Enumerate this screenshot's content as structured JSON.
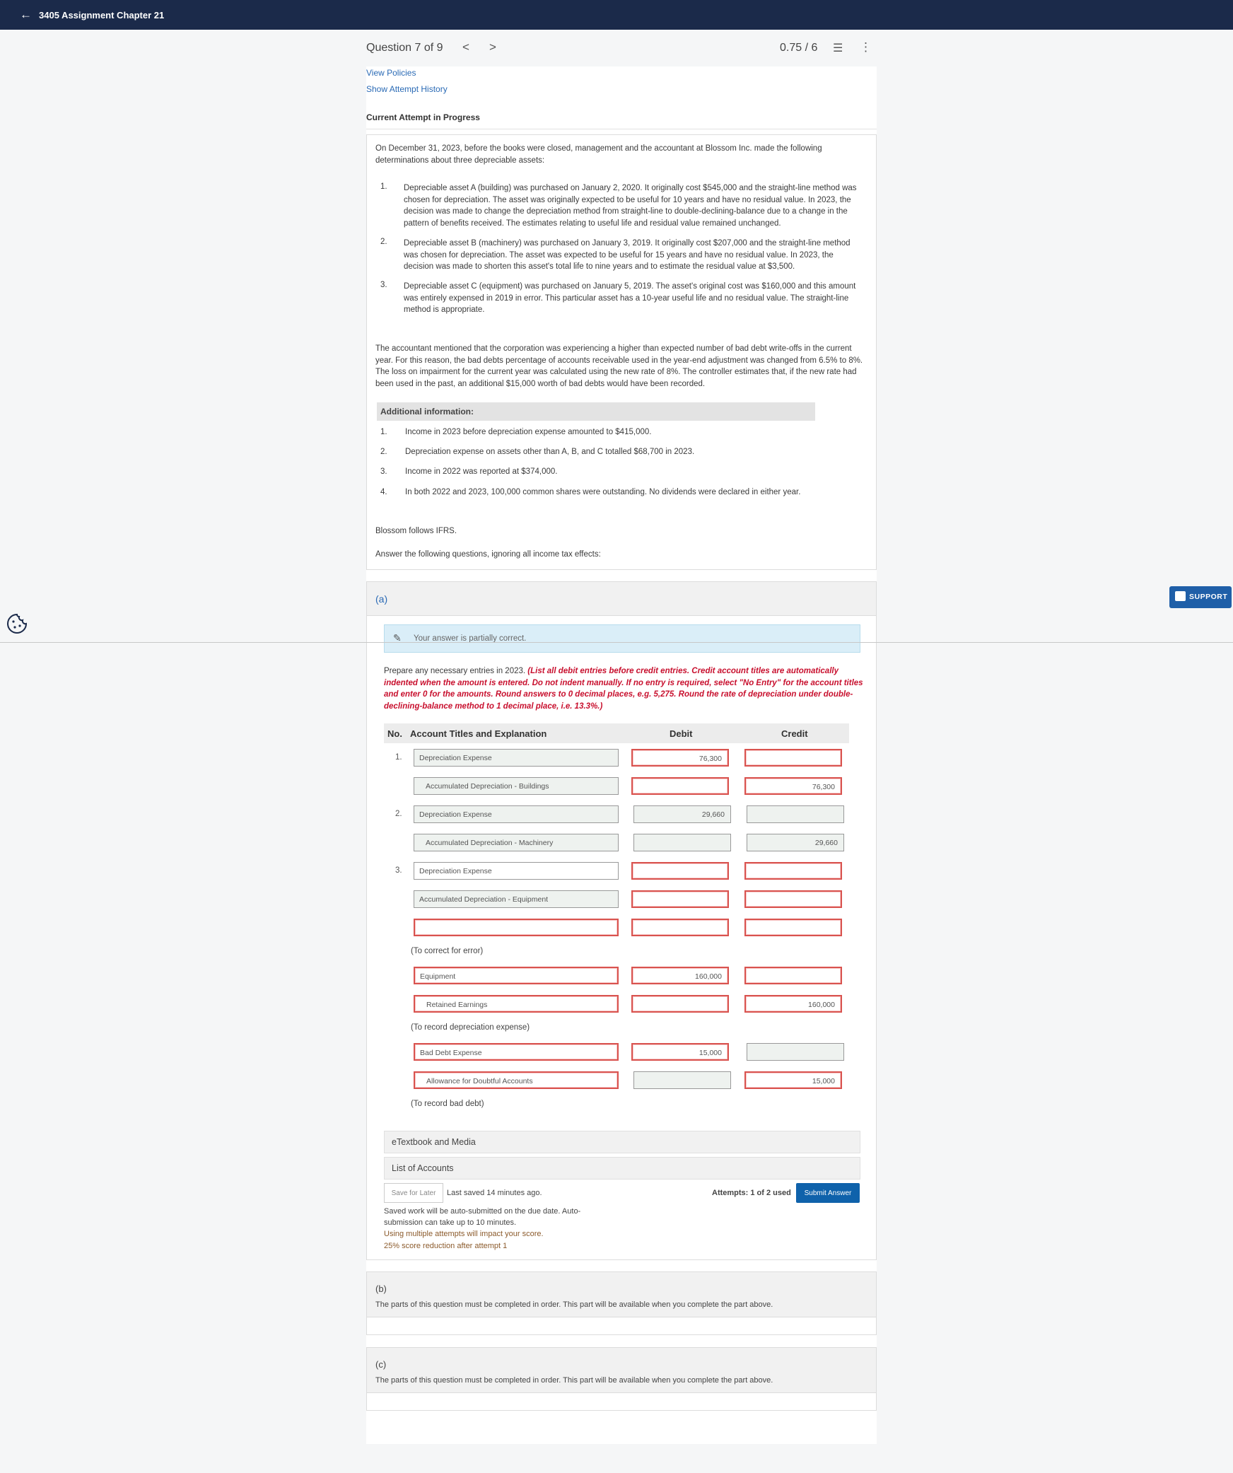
{
  "topbar": {
    "back_icon": "arrow-left-icon",
    "title": "3405 Assignment Chapter 21"
  },
  "header": {
    "question_label": "Question 7 of 9",
    "prev": "<",
    "next": ">",
    "score": "0.75 / 6",
    "list_icon": "☰",
    "more_icon": "⋮"
  },
  "links": {
    "view_policies": "View Policies",
    "show_attempt_history": "Show Attempt History"
  },
  "attempt_title": "Current Attempt in Progress",
  "question": {
    "intro": "On December 31, 2023, before the books were closed, management and the accountant at Blossom Inc. made the following determinations about three depreciable assets:",
    "items": [
      {
        "n": "1.",
        "text": "Depreciable asset A (building) was purchased on January 2, 2020. It originally cost $545,000 and the straight-line method was chosen for depreciation. The asset was originally expected to be useful for 10 years and have no residual value. In 2023, the decision was made to change the depreciation method from straight-line to double-declining-balance due to a change in the pattern of benefits received. The estimates relating to useful life and residual value remained unchanged."
      },
      {
        "n": "2.",
        "text": "Depreciable asset B (machinery) was purchased on January 3, 2019. It originally cost $207,000 and the straight-line method was chosen for depreciation. The asset was expected to be useful for 15 years and have no residual value. In 2023, the decision was made to shorten this asset's total life to nine years and to estimate the residual value at $3,500."
      },
      {
        "n": "3.",
        "text": "Depreciable asset C (equipment) was purchased on January 5, 2019. The asset's original cost was $160,000 and this amount was entirely expensed in 2019 in error. This particular asset has a 10-year useful life and no residual value. The straight-line method is appropriate."
      }
    ],
    "bad_debt": "The accountant mentioned that the corporation was experiencing a higher than expected number of bad debt write-offs in the current year. For this reason, the bad debts percentage of accounts receivable used in the year-end adjustment was changed from 6.5% to 8%. The loss on impairment for the current year was calculated using the new rate of 8%. The controller estimates that, if the new rate had been used in the past, an additional $15,000 worth of bad debts would have been recorded.",
    "additional_title": "Additional information:",
    "additional": [
      {
        "n": "1.",
        "text": "Income in 2023 before depreciation expense amounted to $415,000."
      },
      {
        "n": "2.",
        "text": "Depreciation expense on assets other than A, B, and C totalled $68,700 in 2023."
      },
      {
        "n": "3.",
        "text": "Income in 2022 was reported at $374,000."
      },
      {
        "n": "4.",
        "text": "In both 2022 and 2023, 100,000 common shares were outstanding. No dividends were declared in either year."
      }
    ],
    "ifrs": "Blossom follows IFRS.",
    "answer_prompt": "Answer the following questions, ignoring all income tax effects:"
  },
  "part_a": {
    "label": "(a)",
    "partial_text": "Your answer is partially correct.",
    "instr_plain": "Prepare any necessary entries in 2023. ",
    "instr_red": "(List all debit entries before credit entries. Credit account titles are automatically indented when the amount is entered. Do not indent manually. If no entry is required, select \"No Entry\" for the account titles and enter 0 for the amounts. Round answers to 0 decimal places, e.g. 5,275. Round the rate of depreciation under double-declining-balance method to 1 decimal place, i.e. 13.3%.)",
    "table_headers": {
      "no": "No.",
      "account": "Account Titles and Explanation",
      "debit": "Debit",
      "credit": "Credit"
    },
    "row_numbers": [
      "1.",
      "2.",
      "3."
    ],
    "rows": [
      {
        "account": "Depreciation Expense",
        "debit": "76,300",
        "credit": ""
      },
      {
        "account": "Accumulated Depreciation - Buildings",
        "debit": "",
        "credit": "76,300"
      },
      {
        "account": "Depreciation Expense",
        "debit": "29,660",
        "credit": ""
      },
      {
        "account": "Accumulated Depreciation - Machinery",
        "debit": "",
        "credit": "29,660"
      },
      {
        "account": "Depreciation Expense",
        "debit": "",
        "credit": ""
      },
      {
        "account": "Accumulated Depreciation - Equipment",
        "debit": "",
        "credit": ""
      },
      {
        "account": "",
        "debit": "",
        "credit": ""
      },
      {
        "account": "Equipment",
        "debit": "160,000",
        "credit": ""
      },
      {
        "account": "Retained Earnings",
        "debit": "",
        "credit": "160,000"
      },
      {
        "account": "Bad Debt Expense",
        "debit": "15,000",
        "credit": ""
      },
      {
        "account": "Allowance for Doubtful Accounts",
        "debit": "",
        "credit": "15,000"
      }
    ],
    "notes": [
      "(To correct for error)",
      "(To record depreciation expense)",
      "(To record bad debt)"
    ],
    "etextbook": "eTextbook and Media",
    "list_accounts": "List of Accounts",
    "save_later": "Save for Later",
    "last_saved": "Last saved 14 minutes ago.",
    "auto_submit": "Saved work will be auto-submitted on the due date. Auto-submission can take up to 10 minutes.",
    "multi_attempt": "Using multiple attempts will impact your score.",
    "reduction": "25% score reduction after attempt 1",
    "attempts": "Attempts: 1 of 2 used",
    "submit": "Submit Answer"
  },
  "part_b": {
    "label": "(b)",
    "msg": "The parts of this question must be completed in order. This part will be available when you complete the part above."
  },
  "part_c": {
    "label": "(c)",
    "msg": "The parts of this question must be completed in order. This part will be available when you complete the part above."
  },
  "support": {
    "label": "SUPPORT",
    "icon": "chat-icon"
  },
  "cookie": {
    "icon": "cookie-icon"
  },
  "colors": {
    "topbar": "#1b2a4a",
    "link": "#2a6ab5",
    "error": "#d9534f",
    "submit": "#0f62ab",
    "support": "#1f5fa8"
  }
}
